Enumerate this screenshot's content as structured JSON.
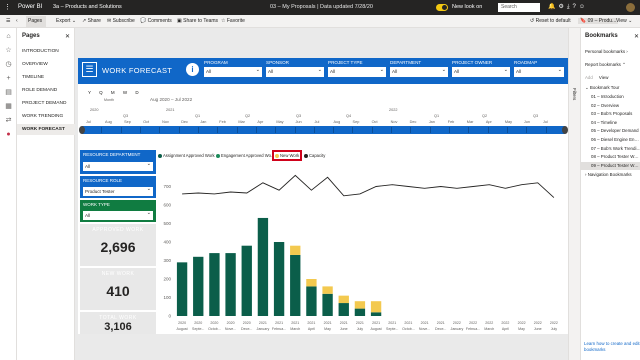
{
  "titlebar": {
    "app": "Power BI",
    "workspace": "3a – Products and Solutions",
    "report": "03 – My Proposals  |  Data updated 7/28/20",
    "new_look": "New look on",
    "search_placeholder": "Search",
    "icons": [
      "bell-icon",
      "gear-icon",
      "download-icon",
      "help-icon",
      "smile-icon"
    ]
  },
  "cmdbar": {
    "pages": "Pages",
    "export": "Export",
    "share": "Share",
    "subscribe": "Subscribe",
    "comments": "Comments",
    "share_teams": "Share to Teams",
    "favorite": "Favorite",
    "reset": "Reset to default",
    "bookmark_menu": "09 – Produ...",
    "view": "View"
  },
  "pages_pane": {
    "title": "Pages",
    "items": [
      "INTRODUCTION",
      "OVERVIEW",
      "TIMELINE",
      "ROLE DEMAND",
      "PROJECT DEMAND",
      "WORK TRENDING",
      "WORK FORECAST"
    ],
    "active_index": 6
  },
  "banner": {
    "title": "WORK FORECAST",
    "slicers": [
      {
        "label": "PROGRAM",
        "value": "All"
      },
      {
        "label": "SPONSOR",
        "value": "All"
      },
      {
        "label": "PROJECT TYPE",
        "value": "All"
      },
      {
        "label": "DEPARTMENT",
        "value": "All"
      },
      {
        "label": "PROJECT OWNER",
        "value": "All"
      },
      {
        "label": "ROADMAP",
        "value": "All"
      }
    ]
  },
  "timeline": {
    "granularity": "Y Q M W D",
    "granularity_label": "Month",
    "range_label": "Aug 2020 – Jul 2022",
    "years": [
      {
        "label": "2020",
        "pos": 0
      },
      {
        "label": "Q3",
        "pos": 0
      },
      {
        "label": "2021",
        "pos": 0
      },
      {
        "label": "Q1",
        "pos": 0
      },
      {
        "label": "Q2",
        "pos": 0
      },
      {
        "label": "Q3",
        "pos": 0
      },
      {
        "label": "Q4",
        "pos": 0
      },
      {
        "label": "2022",
        "pos": 0
      },
      {
        "label": "Q1",
        "pos": 0
      },
      {
        "label": "Q2",
        "pos": 0
      },
      {
        "label": "Q3",
        "pos": 0
      }
    ],
    "months": [
      "Jul",
      "Aug",
      "Sep",
      "Oct",
      "Nov",
      "Dec",
      "Jan",
      "Feb",
      "Mar",
      "Apr",
      "May",
      "Jun",
      "Jul",
      "Aug",
      "Sep",
      "Oct",
      "Nov",
      "Dec",
      "Jan",
      "Feb",
      "Mar",
      "Apr",
      "May",
      "Jun",
      "Jul"
    ]
  },
  "left_filters": {
    "resource_department": {
      "label": "RESOURCE DEPARTMENT",
      "value": "All"
    },
    "resource_role": {
      "label": "RESOURCE ROLE",
      "value": "Product Tester"
    },
    "work_type": {
      "label": "WORK TYPE",
      "value": "All"
    }
  },
  "cards": [
    {
      "title": "APPROVED WORK",
      "value": "2,696"
    },
    {
      "title": "NEW WORK",
      "value": "410"
    },
    {
      "title": "TOTAL WORK",
      "value": "3,106"
    }
  ],
  "legend": {
    "items": [
      {
        "label": "Assignment Approved Work",
        "color": "#0b5e4a"
      },
      {
        "label": "Engagement Approved Wo...",
        "color": "#1b8a5a"
      },
      {
        "label": "New Work",
        "color": "#f3c94f"
      },
      {
        "label": "Capacity",
        "color": "#252423"
      }
    ]
  },
  "chart_data": {
    "type": "bar",
    "stacked": true,
    "ylim": [
      0,
      800
    ],
    "yticks": [
      "0",
      "100",
      "200",
      "300",
      "400",
      "500",
      "600",
      "700"
    ],
    "categories": [
      "2020 August",
      "2020 Septe...",
      "2020 Octob...",
      "2020 Nove...",
      "2020 Dece...",
      "2021 January",
      "2021 Februa...",
      "2021 March",
      "2021 April",
      "2021 May",
      "2021 June",
      "2021 July",
      "2021 August",
      "2021 Septe...",
      "2021 Octob...",
      "2021 Nove...",
      "2021 Dece...",
      "2022 January",
      "2022 Februa...",
      "2022 March",
      "2022 April",
      "2022 May",
      "2022 June",
      "2022 July"
    ],
    "series": [
      {
        "name": "Assignment Approved Work",
        "type": "bar",
        "color": "#0b5e4a",
        "values": [
          290,
          320,
          340,
          340,
          380,
          530,
          400,
          330,
          160,
          120,
          70,
          40,
          20,
          0,
          0,
          0,
          0,
          0,
          0,
          0,
          0,
          0,
          0,
          0
        ]
      },
      {
        "name": "New Work",
        "type": "bar",
        "color": "#f3c94f",
        "values": [
          0,
          0,
          0,
          0,
          0,
          0,
          0,
          50,
          40,
          40,
          40,
          40,
          60,
          0,
          0,
          0,
          0,
          0,
          0,
          0,
          0,
          0,
          0,
          0
        ]
      },
      {
        "name": "Capacity",
        "type": "line",
        "color": "#252423",
        "values": [
          660,
          665,
          660,
          670,
          665,
          720,
          680,
          760,
          680,
          750,
          650,
          660,
          700,
          710,
          700,
          690,
          700,
          690,
          700,
          710,
          690,
          710,
          720,
          640
        ]
      }
    ]
  },
  "right_tab": "Filters",
  "bookmarks": {
    "title": "Bookmarks",
    "personal": "Personal bookmarks",
    "report": "Report bookmarks",
    "add": "Add",
    "view": "View",
    "tour": "Bookmark Tour",
    "items": [
      "01 – Introduction",
      "02 – Overview",
      "03 – Bob's Proposals",
      "04 – Timeline",
      "05 – Developer Demand",
      "06 – Diesel Engine Enha...",
      "07 – Bob's Work Trending",
      "08 – Product Tester Wor...",
      "09 – Product Tester Wor..."
    ],
    "selected_index": 8,
    "navigation": "Navigation Bookmarks",
    "footer": "Learn how to create and edit bookmarks"
  }
}
